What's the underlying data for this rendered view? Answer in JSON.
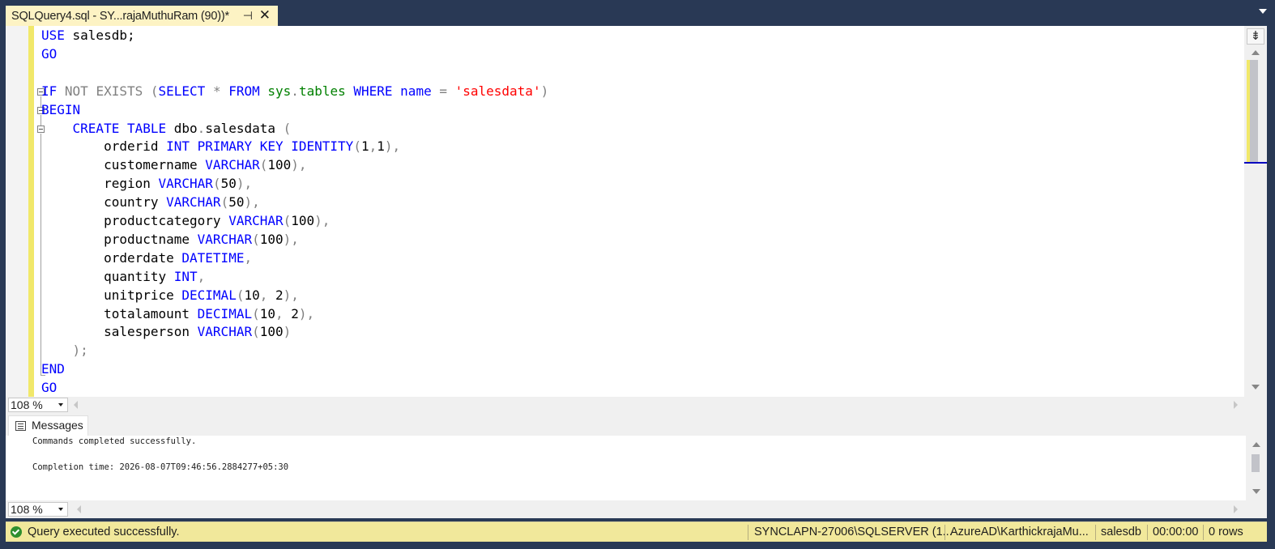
{
  "tab": {
    "title": "SQLQuery4.sql - SY...rajaMuthuRam (90))*",
    "pin_glyph": "⊣",
    "close_glyph": "✕"
  },
  "editor": {
    "lines": [
      {
        "indent": "",
        "tokens": [
          {
            "t": "USE ",
            "c": "kw"
          },
          {
            "t": "salesdb;",
            "c": ""
          }
        ]
      },
      {
        "indent": "",
        "tokens": [
          {
            "t": "GO",
            "c": "kw"
          }
        ]
      },
      {
        "indent": "",
        "tokens": []
      },
      {
        "indent": "",
        "tokens": [
          {
            "t": "IF ",
            "c": "kw"
          },
          {
            "t": "NOT EXISTS ",
            "c": "gray"
          },
          {
            "t": "(",
            "c": "gray"
          },
          {
            "t": "SELECT ",
            "c": "kw"
          },
          {
            "t": "* ",
            "c": "gray"
          },
          {
            "t": "FROM ",
            "c": "kw"
          },
          {
            "t": "sys",
            "c": "sys"
          },
          {
            "t": ".",
            "c": "gray"
          },
          {
            "t": "tables ",
            "c": "sys"
          },
          {
            "t": "WHERE ",
            "c": "kw"
          },
          {
            "t": "name ",
            "c": "kw"
          },
          {
            "t": "= ",
            "c": "gray"
          },
          {
            "t": "'salesdata'",
            "c": "str"
          },
          {
            "t": ")",
            "c": "gray"
          }
        ]
      },
      {
        "indent": "",
        "tokens": [
          {
            "t": "BEGIN",
            "c": "kw"
          }
        ]
      },
      {
        "indent": "    ",
        "tokens": [
          {
            "t": "CREATE TABLE ",
            "c": "kw"
          },
          {
            "t": "dbo",
            "c": ""
          },
          {
            "t": ".",
            "c": "gray"
          },
          {
            "t": "salesdata ",
            "c": ""
          },
          {
            "t": "(",
            "c": "gray"
          }
        ]
      },
      {
        "indent": "        ",
        "tokens": [
          {
            "t": "orderid ",
            "c": ""
          },
          {
            "t": "INT PRIMARY KEY IDENTITY",
            "c": "kw"
          },
          {
            "t": "(",
            "c": "gray"
          },
          {
            "t": "1",
            "c": ""
          },
          {
            "t": ",",
            "c": "gray"
          },
          {
            "t": "1",
            "c": ""
          },
          {
            "t": "),",
            "c": "gray"
          }
        ]
      },
      {
        "indent": "        ",
        "tokens": [
          {
            "t": "customername ",
            "c": ""
          },
          {
            "t": "VARCHAR",
            "c": "kw"
          },
          {
            "t": "(",
            "c": "gray"
          },
          {
            "t": "100",
            "c": ""
          },
          {
            "t": "),",
            "c": "gray"
          }
        ]
      },
      {
        "indent": "        ",
        "tokens": [
          {
            "t": "region ",
            "c": ""
          },
          {
            "t": "VARCHAR",
            "c": "kw"
          },
          {
            "t": "(",
            "c": "gray"
          },
          {
            "t": "50",
            "c": ""
          },
          {
            "t": "),",
            "c": "gray"
          }
        ]
      },
      {
        "indent": "        ",
        "tokens": [
          {
            "t": "country ",
            "c": ""
          },
          {
            "t": "VARCHAR",
            "c": "kw"
          },
          {
            "t": "(",
            "c": "gray"
          },
          {
            "t": "50",
            "c": ""
          },
          {
            "t": "),",
            "c": "gray"
          }
        ]
      },
      {
        "indent": "        ",
        "tokens": [
          {
            "t": "productcategory ",
            "c": ""
          },
          {
            "t": "VARCHAR",
            "c": "kw"
          },
          {
            "t": "(",
            "c": "gray"
          },
          {
            "t": "100",
            "c": ""
          },
          {
            "t": "),",
            "c": "gray"
          }
        ]
      },
      {
        "indent": "        ",
        "tokens": [
          {
            "t": "productname ",
            "c": ""
          },
          {
            "t": "VARCHAR",
            "c": "kw"
          },
          {
            "t": "(",
            "c": "gray"
          },
          {
            "t": "100",
            "c": ""
          },
          {
            "t": "),",
            "c": "gray"
          }
        ]
      },
      {
        "indent": "        ",
        "tokens": [
          {
            "t": "orderdate ",
            "c": ""
          },
          {
            "t": "DATETIME",
            "c": "kw"
          },
          {
            "t": ",",
            "c": "gray"
          }
        ]
      },
      {
        "indent": "        ",
        "tokens": [
          {
            "t": "quantity ",
            "c": ""
          },
          {
            "t": "INT",
            "c": "kw"
          },
          {
            "t": ",",
            "c": "gray"
          }
        ]
      },
      {
        "indent": "        ",
        "tokens": [
          {
            "t": "unitprice ",
            "c": ""
          },
          {
            "t": "DECIMAL",
            "c": "kw"
          },
          {
            "t": "(",
            "c": "gray"
          },
          {
            "t": "10",
            "c": ""
          },
          {
            "t": ", ",
            "c": "gray"
          },
          {
            "t": "2",
            "c": ""
          },
          {
            "t": "),",
            "c": "gray"
          }
        ]
      },
      {
        "indent": "        ",
        "tokens": [
          {
            "t": "totalamount ",
            "c": ""
          },
          {
            "t": "DECIMAL",
            "c": "kw"
          },
          {
            "t": "(",
            "c": "gray"
          },
          {
            "t": "10",
            "c": ""
          },
          {
            "t": ", ",
            "c": "gray"
          },
          {
            "t": "2",
            "c": ""
          },
          {
            "t": "),",
            "c": "gray"
          }
        ]
      },
      {
        "indent": "        ",
        "tokens": [
          {
            "t": "salesperson ",
            "c": ""
          },
          {
            "t": "VARCHAR",
            "c": "kw"
          },
          {
            "t": "(",
            "c": "gray"
          },
          {
            "t": "100",
            "c": ""
          },
          {
            "t": ")",
            "c": "gray"
          }
        ]
      },
      {
        "indent": "    ",
        "tokens": [
          {
            "t": ");",
            "c": "gray"
          }
        ]
      },
      {
        "indent": "",
        "tokens": [
          {
            "t": "END",
            "c": "kw"
          }
        ]
      },
      {
        "indent": "",
        "tokens": [
          {
            "t": "GO",
            "c": "kw"
          }
        ]
      }
    ]
  },
  "editor_zoom": {
    "value": "108 %"
  },
  "results": {
    "tab_label": "Messages",
    "messages": [
      "Commands completed successfully.",
      "",
      "Completion time: 2026-08-07T09:46:56.2884277+05:30"
    ]
  },
  "results_zoom": {
    "value": "108 %"
  },
  "status": {
    "message": "Query executed successfully.",
    "server": "SYNCLAPN-27006\\SQLSERVER (1...",
    "user": "AzureAD\\KarthickrajaMu...",
    "database": "salesdb",
    "elapsed": "00:00:00",
    "rows": "0 rows"
  },
  "colors": {
    "keyword": "#0000ff",
    "operator": "#808080",
    "system_object": "#008000",
    "string": "#ff0000",
    "tab_active": "#fdf3c4",
    "status_bar": "#f1e89b",
    "frame": "#293955"
  },
  "icons": {
    "split": "split-window-icon",
    "messages": "messages-icon",
    "status": "success-check-icon"
  }
}
